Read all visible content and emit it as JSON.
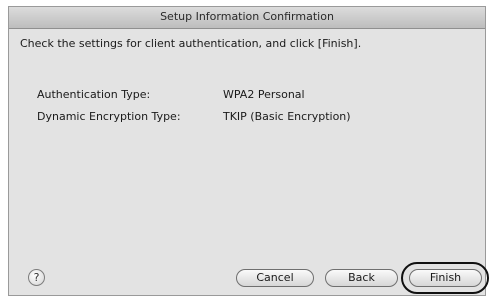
{
  "window": {
    "title": "Setup Information Confirmation"
  },
  "instruction": "Check the settings for client authentication, and click [Finish].",
  "settings": [
    {
      "label": "Authentication Type:",
      "value": "WPA2 Personal"
    },
    {
      "label": "Dynamic Encryption Type:",
      "value": "TKIP (Basic Encryption)"
    }
  ],
  "buttons": {
    "help": "?",
    "cancel": "Cancel",
    "back": "Back",
    "finish": "Finish"
  }
}
